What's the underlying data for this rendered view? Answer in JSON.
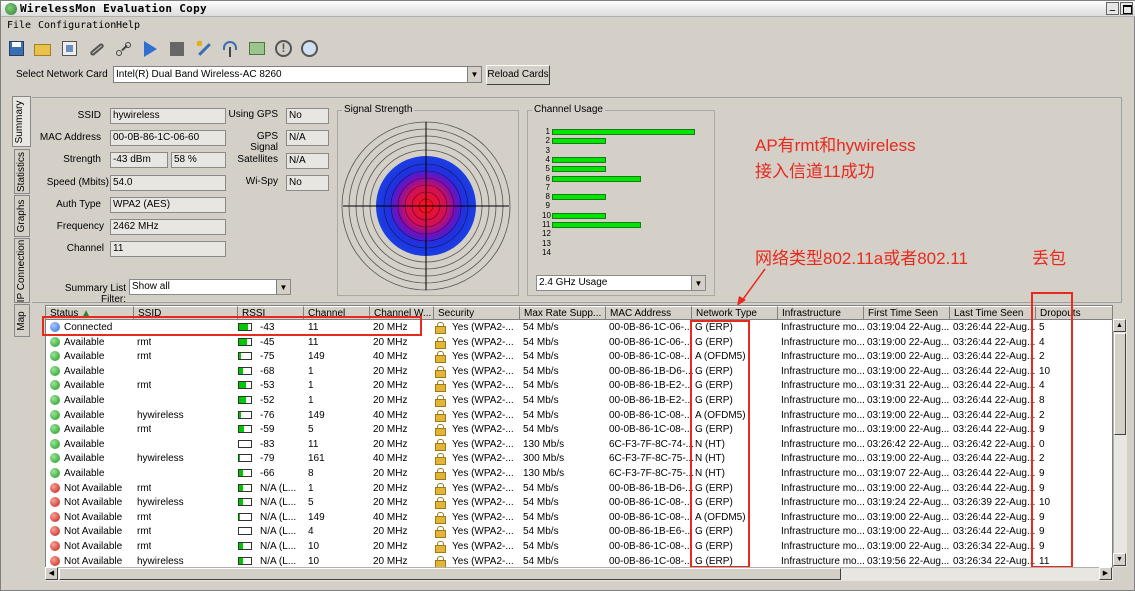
{
  "window": {
    "title": "WirelessMon Evaluation Copy",
    "minimize_glyph": "_"
  },
  "menu": [
    "File",
    "Configuration",
    "Help"
  ],
  "toolbar": {
    "icons": [
      "save-icon",
      "open-folder-icon",
      "export-icon",
      "link-icon",
      "network-nodes-icon",
      "play-icon",
      "stop-icon",
      "wand-icon",
      "signal-tower-icon",
      "map-icon",
      "info-icon",
      "help-globe-icon"
    ]
  },
  "network_card": {
    "label": "Select Network Card",
    "value": "Intel(R) Dual Band Wireless-AC 8260",
    "reload_label": "Reload Cards"
  },
  "tabs": [
    "Summary",
    "Statistics",
    "Graphs",
    "IP Connection",
    "Map"
  ],
  "summary": {
    "ssid_label": "SSID",
    "ssid": "hywireless",
    "mac_label": "MAC Address",
    "mac": "00-0B-86-1C-06-60",
    "strength_label": "Strength",
    "strength_dbm": "-43 dBm",
    "strength_pct": "58 %",
    "speed_label": "Speed (Mbits)",
    "speed": "54.0",
    "auth_label": "Auth Type",
    "auth": "WPA2 (AES)",
    "freq_label": "Frequency",
    "freq": "2462 MHz",
    "channel_label": "Channel",
    "channel": "11",
    "gps_label": "Using GPS",
    "gps": "No",
    "gps_signal_label": "GPS Signal",
    "gps_signal": "N/A",
    "satellites_label": "Satellites",
    "satellites": "N/A",
    "wispy_label": "Wi-Spy",
    "wispy": "No",
    "filter_label": "Summary List Filter:",
    "filter_value": "Show all"
  },
  "signal_strength": {
    "title": "Signal Strength"
  },
  "channel_usage": {
    "title": "Channel Usage",
    "band_select": "2.4 GHz Usage",
    "channels": [
      "1",
      "2",
      "3",
      "4",
      "5",
      "6",
      "7",
      "8",
      "9",
      "10",
      "11",
      "12",
      "13",
      "14"
    ],
    "usage": [
      8,
      3,
      0,
      3,
      3,
      5,
      0,
      3,
      0,
      3,
      5,
      0,
      0,
      0
    ],
    "max_usage": 8
  },
  "annotations": {
    "ap_line1": "AP有rmt和hywireless",
    "ap_line2": "接入信道11成功",
    "network_type": "网络类型802.11a或者802.11",
    "dropouts": "丢包"
  },
  "table": {
    "columns": [
      "Status",
      "SSID",
      "RSSI",
      "Channel",
      "Channel W...",
      "Security",
      "Max Rate Supp...",
      "MAC Address",
      "Network Type",
      "Infrastructure",
      "First Time Seen",
      "Last Time Seen",
      "Dropouts"
    ],
    "rows": [
      {
        "status": "Connected",
        "state": "connected",
        "ssid": "",
        "rssi": "-43",
        "level": 0.75,
        "channel": "11",
        "width": "20 MHz",
        "security": "Yes (WPA2-...",
        "rate": "54 Mb/s",
        "mac": "00-0B-86-1C-06-...",
        "type": "G (ERP)",
        "infra": "Infrastructure mo...",
        "first": "03:19:04 22-Aug...",
        "last": "03:26:44 22-Aug...",
        "drops": "5"
      },
      {
        "status": "Available",
        "state": "available",
        "ssid": "rmt",
        "rssi": "-45",
        "level": 0.7,
        "channel": "11",
        "width": "20 MHz",
        "security": "Yes (WPA2-...",
        "rate": "54 Mb/s",
        "mac": "00-0B-86-1C-06-...",
        "type": "G (ERP)",
        "infra": "Infrastructure mo...",
        "first": "03:19:00 22-Aug...",
        "last": "03:26:44 22-Aug...",
        "drops": "4"
      },
      {
        "status": "Available",
        "state": "available",
        "ssid": "rmt",
        "rssi": "-75",
        "level": 0.15,
        "channel": "149",
        "width": "40 MHz",
        "security": "Yes (WPA2-...",
        "rate": "54 Mb/s",
        "mac": "00-0B-86-1C-08-...",
        "type": "A (OFDM5)",
        "infra": "Infrastructure mo...",
        "first": "03:19:00 22-Aug...",
        "last": "03:26:44 22-Aug...",
        "drops": "2"
      },
      {
        "status": "Available",
        "state": "available",
        "ssid": "",
        "rssi": "-68",
        "level": 0.3,
        "channel": "1",
        "width": "20 MHz",
        "security": "Yes (WPA2-...",
        "rate": "54 Mb/s",
        "mac": "00-0B-86-1B-D6-...",
        "type": "G (ERP)",
        "infra": "Infrastructure mo...",
        "first": "03:19:00 22-Aug...",
        "last": "03:26:44 22-Aug...",
        "drops": "10"
      },
      {
        "status": "Available",
        "state": "available",
        "ssid": "rmt",
        "rssi": "-53",
        "level": 0.55,
        "channel": "1",
        "width": "20 MHz",
        "security": "Yes (WPA2-...",
        "rate": "54 Mb/s",
        "mac": "00-0B-86-1B-E2-...",
        "type": "G (ERP)",
        "infra": "Infrastructure mo...",
        "first": "03:19:31 22-Aug...",
        "last": "03:26:44 22-Aug...",
        "drops": "4"
      },
      {
        "status": "Available",
        "state": "available",
        "ssid": "",
        "rssi": "-52",
        "level": 0.55,
        "channel": "1",
        "width": "20 MHz",
        "security": "Yes (WPA2-...",
        "rate": "54 Mb/s",
        "mac": "00-0B-86-1B-E2-...",
        "type": "G (ERP)",
        "infra": "Infrastructure mo...",
        "first": "03:19:00 22-Aug...",
        "last": "03:26:44 22-Aug...",
        "drops": "8"
      },
      {
        "status": "Available",
        "state": "available",
        "ssid": "hywireless",
        "rssi": "-76",
        "level": 0.15,
        "channel": "149",
        "width": "40 MHz",
        "security": "Yes (WPA2-...",
        "rate": "54 Mb/s",
        "mac": "00-0B-86-1C-08-...",
        "type": "A (OFDM5)",
        "infra": "Infrastructure mo...",
        "first": "03:19:00 22-Aug...",
        "last": "03:26:44 22-Aug...",
        "drops": "2"
      },
      {
        "status": "Available",
        "state": "available",
        "ssid": "rmt",
        "rssi": "-59",
        "level": 0.45,
        "channel": "5",
        "width": "20 MHz",
        "security": "Yes (WPA2-...",
        "rate": "54 Mb/s",
        "mac": "00-0B-86-1C-08-...",
        "type": "G (ERP)",
        "infra": "Infrastructure mo...",
        "first": "03:19:00 22-Aug...",
        "last": "03:26:44 22-Aug...",
        "drops": "9"
      },
      {
        "status": "Available",
        "state": "available",
        "ssid": "",
        "rssi": "-83",
        "level": 0,
        "channel": "11",
        "width": "20 MHz",
        "security": "Yes (WPA2-...",
        "rate": "130 Mb/s",
        "mac": "6C-F3-7F-8C-74-...",
        "type": "N (HT)",
        "infra": "Infrastructure mo...",
        "first": "03:26:42 22-Aug...",
        "last": "03:26:42 22-Aug...",
        "drops": "0"
      },
      {
        "status": "Available",
        "state": "available",
        "ssid": "hywireless",
        "rssi": "-79",
        "level": 0.1,
        "channel": "161",
        "width": "40 MHz",
        "security": "Yes (WPA2-...",
        "rate": "300 Mb/s",
        "mac": "6C-F3-7F-8C-75-...",
        "type": "N (HT)",
        "infra": "Infrastructure mo...",
        "first": "03:19:00 22-Aug...",
        "last": "03:26:44 22-Aug...",
        "drops": "2"
      },
      {
        "status": "Available",
        "state": "available",
        "ssid": "",
        "rssi": "-66",
        "level": 0.3,
        "channel": "8",
        "width": "20 MHz",
        "security": "Yes (WPA2-...",
        "rate": "130 Mb/s",
        "mac": "6C-F3-7F-8C-75-...",
        "type": "N (HT)",
        "infra": "Infrastructure mo...",
        "first": "03:19:07 22-Aug...",
        "last": "03:26:44 22-Aug...",
        "drops": "9"
      },
      {
        "status": "Not Available",
        "state": "unavailable",
        "ssid": "rmt",
        "rssi": "N/A (L...",
        "level": 0.3,
        "channel": "1",
        "width": "20 MHz",
        "security": "Yes (WPA2-...",
        "rate": "54 Mb/s",
        "mac": "00-0B-86-1B-D6-...",
        "type": "G (ERP)",
        "infra": "Infrastructure mo...",
        "first": "03:19:00 22-Aug...",
        "last": "03:26:44 22-Aug...",
        "drops": "9"
      },
      {
        "status": "Not Available",
        "state": "unavailable",
        "ssid": "hywireless",
        "rssi": "N/A (L...",
        "level": 0.3,
        "channel": "5",
        "width": "20 MHz",
        "security": "Yes (WPA2-...",
        "rate": "54 Mb/s",
        "mac": "00-0B-86-1C-08-...",
        "type": "G (ERP)",
        "infra": "Infrastructure mo...",
        "first": "03:19:24 22-Aug...",
        "last": "03:26:39 22-Aug...",
        "drops": "10"
      },
      {
        "status": "Not Available",
        "state": "unavailable",
        "ssid": "rmt",
        "rssi": "N/A (L...",
        "level": 0.1,
        "channel": "149",
        "width": "40 MHz",
        "security": "Yes (WPA2-...",
        "rate": "54 Mb/s",
        "mac": "00-0B-86-1C-08-...",
        "type": "A (OFDM5)",
        "infra": "Infrastructure mo...",
        "first": "03:19:00 22-Aug...",
        "last": "03:26:44 22-Aug...",
        "drops": "9"
      },
      {
        "status": "Not Available",
        "state": "unavailable",
        "ssid": "rmt",
        "rssi": "N/A (L...",
        "level": 0,
        "channel": "4",
        "width": "20 MHz",
        "security": "Yes (WPA2-...",
        "rate": "54 Mb/s",
        "mac": "00-0B-86-1B-E6-...",
        "type": "G (ERP)",
        "infra": "Infrastructure mo...",
        "first": "03:19:00 22-Aug...",
        "last": "03:26:44 22-Aug...",
        "drops": "9"
      },
      {
        "status": "Not Available",
        "state": "unavailable",
        "ssid": "rmt",
        "rssi": "N/A (L...",
        "level": 0.3,
        "channel": "10",
        "width": "20 MHz",
        "security": "Yes (WPA2-...",
        "rate": "54 Mb/s",
        "mac": "00-0B-86-1C-08-...",
        "type": "G (ERP)",
        "infra": "Infrastructure mo...",
        "first": "03:19:00 22-Aug...",
        "last": "03:26:34 22-Aug...",
        "drops": "9"
      },
      {
        "status": "Not Available",
        "state": "unavailable",
        "ssid": "hywireless",
        "rssi": "N/A (L...",
        "level": 0.3,
        "channel": "10",
        "width": "20 MHz",
        "security": "Yes (WPA2-...",
        "rate": "54 Mb/s",
        "mac": "00-0B-86-1C-08-...",
        "type": "G (ERP)",
        "infra": "Infrastructure mo...",
        "first": "03:19:56 22-Aug...",
        "last": "03:26:34 22-Aug...",
        "drops": "11"
      }
    ]
  }
}
